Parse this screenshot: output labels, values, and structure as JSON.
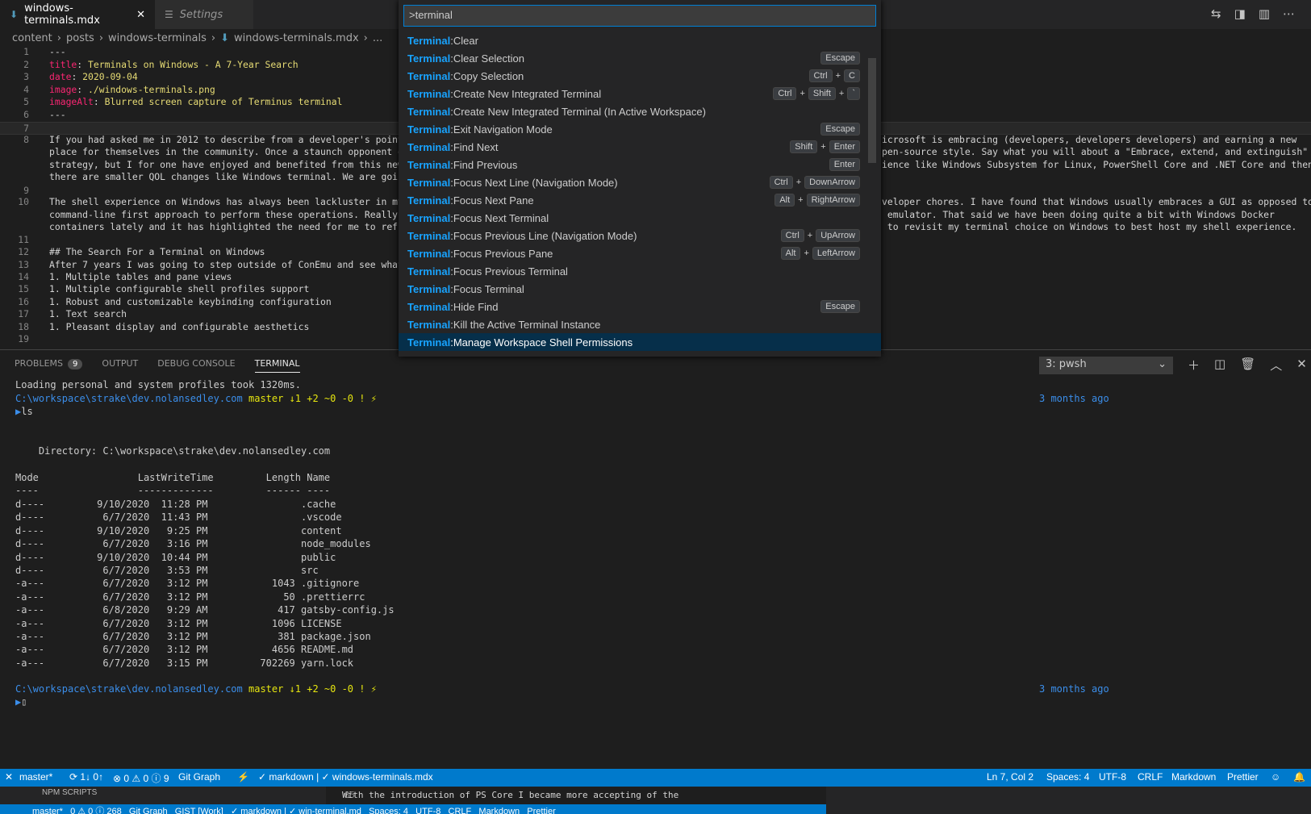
{
  "tabs": [
    {
      "label": "windows-terminals.mdx",
      "active": true
    },
    {
      "label": "Settings",
      "active": false
    }
  ],
  "breadcrumb": [
    "content",
    "posts",
    "windows-terminals",
    "windows-terminals.mdx",
    "..."
  ],
  "editor": {
    "lines": [
      {
        "n": "1",
        "text": "---"
      },
      {
        "n": "2",
        "key": "title",
        "value": "Terminals on Windows - A 7-Year Search"
      },
      {
        "n": "3",
        "key": "date",
        "value": "2020-09-04"
      },
      {
        "n": "4",
        "key": "image",
        "value": "./windows-terminals.png"
      },
      {
        "n": "5",
        "key": "imageAlt",
        "value": "Blurred screen capture of Terminus terminal"
      },
      {
        "n": "6",
        "text": "---"
      },
      {
        "n": "7",
        "text": ""
      },
      {
        "n": "8",
        "text": "If you had asked me in 2012 to describe from a developer's point-o"
      },
      {
        "n": "",
        "text": "place for themselves in the community. Once a staunch opponent of"
      },
      {
        "n": "",
        "text": "strategy, but I for one have enjoyed and benefited from this new s"
      },
      {
        "n": "",
        "text": "there are smaller QOL changes like Windows terminal. We are going"
      },
      {
        "n": "9",
        "text": ""
      },
      {
        "n": "10",
        "text": "The shell experience on Windows has always been lackluster in my o"
      },
      {
        "n": "",
        "text": "command-line first approach to perform these operations. Really th"
      },
      {
        "n": "",
        "text": "containers lately and it has highlighted the need for me to refres"
      },
      {
        "n": "11",
        "text": ""
      },
      {
        "n": "12",
        "head": "## The Search For a Terminal on Windows"
      },
      {
        "n": "13",
        "text": "After 7 years I was going to step outside of ConEmu and see what c"
      },
      {
        "n": "14",
        "list": "1. Multiple tables and pane views"
      },
      {
        "n": "15",
        "list": "1. Multiple configurable shell profiles support"
      },
      {
        "n": "16",
        "list": "1. Robust and customizable keybinding configuration"
      },
      {
        "n": "17",
        "list": "1. Text search"
      },
      {
        "n": "18",
        "list": "1. Pleasant display and configurable aesthetics"
      },
      {
        "n": "19",
        "text": ""
      }
    ],
    "right_overflow": [
      "icrosoft is embracing (developers, developers developers) and earning a new",
      "pen-source style. Say what you will about a \"Embrace, extend, and extinguish\"",
      "ience like Windows Subsystem for Linux, PowerShell Core and .NET Core and then",
      "",
      "veloper chores. I have found that Windows usually embraces a GUI as opposed to",
      " emulator. That said we have been doing quite a bit with Windows Docker",
      " to revisit my terminal choice on Windows to best host my shell experience."
    ]
  },
  "palette": {
    "query": ">terminal",
    "prefix": "Terminal",
    "commands": [
      {
        "label": "Clear",
        "keys": []
      },
      {
        "label": "Clear Selection",
        "keys": [
          "Escape"
        ]
      },
      {
        "label": "Copy Selection",
        "keys": [
          "Ctrl",
          "C"
        ]
      },
      {
        "label": "Create New Integrated Terminal",
        "keys": [
          "Ctrl",
          "Shift",
          "`"
        ]
      },
      {
        "label": "Create New Integrated Terminal (In Active Workspace)",
        "keys": []
      },
      {
        "label": "Exit Navigation Mode",
        "keys": [
          "Escape"
        ]
      },
      {
        "label": "Find Next",
        "keys": [
          "Shift",
          "Enter"
        ]
      },
      {
        "label": "Find Previous",
        "keys": [
          "Enter"
        ]
      },
      {
        "label": "Focus Next Line (Navigation Mode)",
        "keys": [
          "Ctrl",
          "DownArrow"
        ]
      },
      {
        "label": "Focus Next Pane",
        "keys": [
          "Alt",
          "RightArrow"
        ]
      },
      {
        "label": "Focus Next Terminal",
        "keys": []
      },
      {
        "label": "Focus Previous Line (Navigation Mode)",
        "keys": [
          "Ctrl",
          "UpArrow"
        ]
      },
      {
        "label": "Focus Previous Pane",
        "keys": [
          "Alt",
          "LeftArrow"
        ]
      },
      {
        "label": "Focus Previous Terminal",
        "keys": []
      },
      {
        "label": "Focus Terminal",
        "keys": []
      },
      {
        "label": "Hide Find",
        "keys": [
          "Escape"
        ]
      },
      {
        "label": "Kill the Active Terminal Instance",
        "keys": []
      },
      {
        "label": "Manage Workspace Shell Permissions",
        "keys": [],
        "selected": true
      }
    ]
  },
  "panel": {
    "tabs": [
      "PROBLEMS",
      "OUTPUT",
      "DEBUG CONSOLE",
      "TERMINAL"
    ],
    "problems_count": "9",
    "terminal_select": "3: pwsh"
  },
  "terminal": {
    "loading": "Loading personal and system profiles took 1320ms.",
    "path": "C:\\workspace\\strake\\dev.nolansedley.com",
    "git": " master ↓1 +2 ~0 -0 ! ⚡",
    "time": "3 months ago",
    "command": "ls",
    "directory": "    Directory: C:\\workspace\\strake\\dev.nolansedley.com",
    "header": "Mode                 LastWriteTime         Length Name",
    "divider": "----                 -------------         ------ ----",
    "rows": [
      "d----         9/10/2020  11:28 PM                .cache",
      "d----          6/7/2020  11:43 PM                .vscode",
      "d----         9/10/2020   9:25 PM                content",
      "d----          6/7/2020   3:16 PM                node_modules",
      "d----         9/10/2020  10:44 PM                public",
      "d----          6/7/2020   3:53 PM                src",
      "-a---          6/7/2020   3:12 PM           1043 .gitignore",
      "-a---          6/7/2020   3:12 PM             50 .prettierrc",
      "-a---          6/8/2020   9:29 AM            417 gatsby-config.js",
      "-a---          6/7/2020   3:12 PM           1096 LICENSE",
      "-a---          6/7/2020   3:12 PM            381 package.json",
      "-a---          6/7/2020   3:12 PM           4656 README.md",
      "-a---          6/7/2020   3:15 PM         702269 yarn.lock"
    ]
  },
  "statusbar": {
    "branch": "master*",
    "sync": "1↓ 0↑",
    "problems": "0 ⚠ 0 ⓘ 9",
    "git_graph": "Git Graph",
    "lang_check": "✓ markdown | ✓ windows-terminals.mdx",
    "position": "Ln 7, Col 2",
    "spaces": "Spaces: 4",
    "encoding": "UTF-8",
    "eol": "CRLF",
    "language": "Markdown",
    "formatter": "Prettier"
  },
  "under": {
    "npm": "NPM SCRIPTS",
    "line_no": "85",
    "line_text": "With the introduction of PS Core I became more accepting of the",
    "status": "master*   0 ⚠ 0 ⓘ 268   Git Graph   GIST [Work]   ✓ markdown | ✓ win-terminal.md   Spaces: 4   UTF-8   CRLF   Markdown   Prettier"
  }
}
